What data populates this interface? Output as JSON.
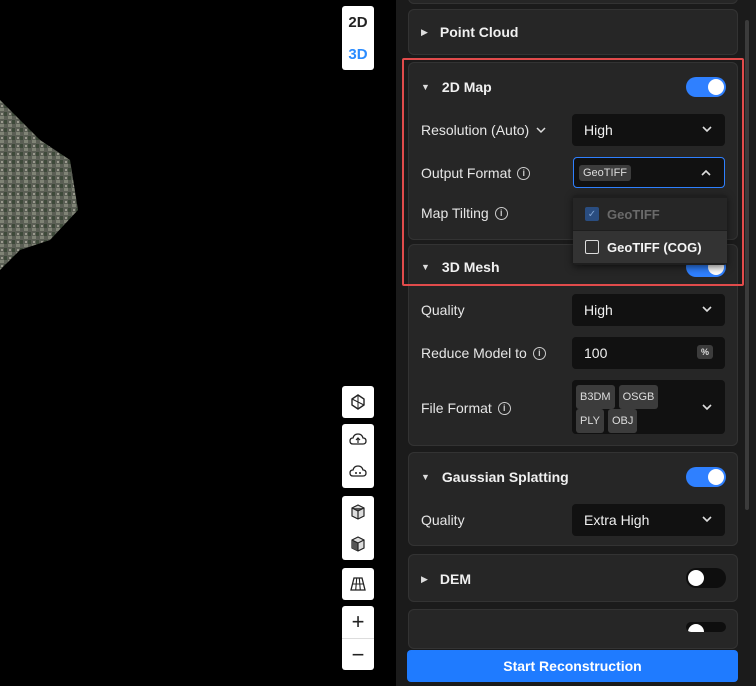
{
  "view_mode": {
    "btn_2d": "2D",
    "btn_3d": "3D",
    "active": "3D"
  },
  "map_tools": {
    "icons": [
      "compass-icon",
      "cloud-upload-icon",
      "cloud-download-icon",
      "cube-top-icon",
      "cube-front-icon",
      "grid-icon"
    ],
    "zoom_in": "+",
    "zoom_out": "−"
  },
  "panel": {
    "point_cloud": {
      "title": "Point Cloud",
      "expanded": false
    },
    "map2d": {
      "title": "2D Map",
      "enabled": true,
      "resolution_label": "Resolution (Auto)",
      "resolution_value": "High",
      "output_format_label": "Output Format",
      "output_format_value": "GeoTIFF",
      "map_tilting_label": "Map Tilting",
      "dropdown_options": [
        {
          "label": "GeoTIFF",
          "checked": true,
          "disabled": true
        },
        {
          "label": "GeoTIFF (COG)",
          "checked": false,
          "disabled": false
        }
      ]
    },
    "mesh3d": {
      "title": "3D Mesh",
      "enabled": true,
      "quality_label": "Quality",
      "quality_value": "High",
      "reduce_label": "Reduce Model to",
      "reduce_value": "100",
      "reduce_unit": "%",
      "file_format_label": "File Format",
      "file_formats": [
        "B3DM",
        "OSGB",
        "PLY",
        "OBJ"
      ]
    },
    "gaussian": {
      "title": "Gaussian Splatting",
      "enabled": true,
      "quality_label": "Quality",
      "quality_value": "Extra High"
    },
    "dem": {
      "title": "DEM",
      "enabled": false
    },
    "start_button": "Start Reconstruction"
  },
  "colors": {
    "accent": "#1f7bff",
    "highlight": "#e14b4b",
    "panel_bg": "#1b1b1b",
    "card_bg": "#262626"
  }
}
